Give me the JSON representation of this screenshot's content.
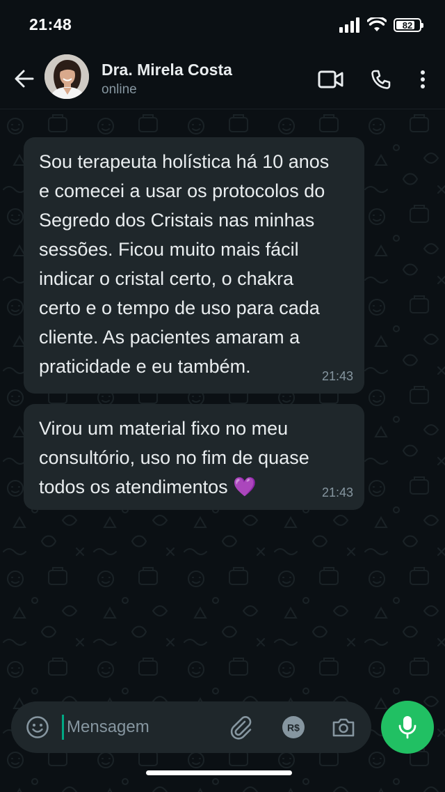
{
  "status_bar": {
    "time": "21:48",
    "battery_level": "82",
    "battery_fraction": 0.82
  },
  "header": {
    "back_icon": "arrow-left-icon",
    "contact_name": "Dra. Mirela Costa",
    "contact_status": "online",
    "video_icon": "video-call-icon",
    "call_icon": "phone-icon",
    "menu_icon": "more-vertical-icon"
  },
  "messages": [
    {
      "text": "Sou terapeuta holística há 10 anos\ne comecei a usar os protocolos do\nSegredo dos Cristais nas minhas\nsessões. Ficou muito mais fácil\nindicar o cristal certo, o chakra\ncerto e o tempo de uso para cada\ncliente. As pacientes amaram a\npraticidade e eu também.",
      "time": "21:43"
    },
    {
      "text": "Virou um material fixo no meu\nconsultório, uso no fim de quase\ntodos os atendimentos 💜",
      "time": "21:43"
    }
  ],
  "composer": {
    "placeholder": "Mensagem",
    "emoji_icon": "emoji-icon",
    "attach_icon": "paperclip-icon",
    "payment_icon": "payment-rs-icon",
    "payment_label": "R$",
    "camera_icon": "camera-icon",
    "mic_icon": "microphone-icon"
  },
  "colors": {
    "background": "#0b1014",
    "bubble": "#1f272b",
    "accent": "#21c063",
    "caret": "#00a884",
    "secondary_text": "#8696a0"
  }
}
